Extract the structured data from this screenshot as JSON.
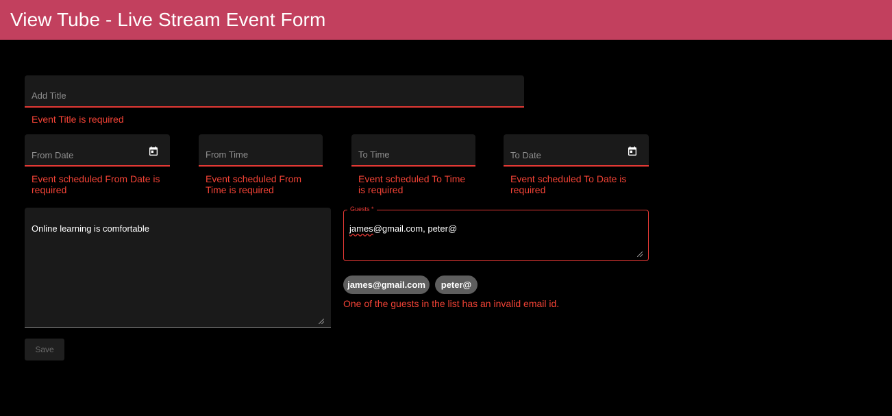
{
  "header": {
    "title": "View Tube - Live Stream Event Form"
  },
  "form": {
    "title_field": {
      "placeholder": "Add Title",
      "error": "Event Title is required"
    },
    "from_date": {
      "label": "From Date",
      "error": "Event scheduled From Date is required"
    },
    "from_time": {
      "label": "From Time",
      "error": "Event scheduled From Time is required"
    },
    "to_time": {
      "label": "To Time",
      "error": "Event scheduled To Time is required"
    },
    "to_date": {
      "label": "To Date",
      "error": "Event scheduled To Date is required"
    },
    "description": {
      "value": "Online learning is comfortable"
    },
    "guests": {
      "label": "Guests *",
      "value_underlined": "james",
      "value_rest": "@gmail.com, peter@",
      "chips": [
        "james@gmail.com",
        "peter@"
      ],
      "error": "One of the guests in the list has an invalid email id."
    },
    "save_label": "Save"
  },
  "icons": {
    "date_picker": "calendar-icon"
  },
  "colors": {
    "header_bg": "#c2405e",
    "error": "#f44336",
    "field_bg": "#1a1a1a",
    "chip_bg": "#5e5e5e"
  }
}
